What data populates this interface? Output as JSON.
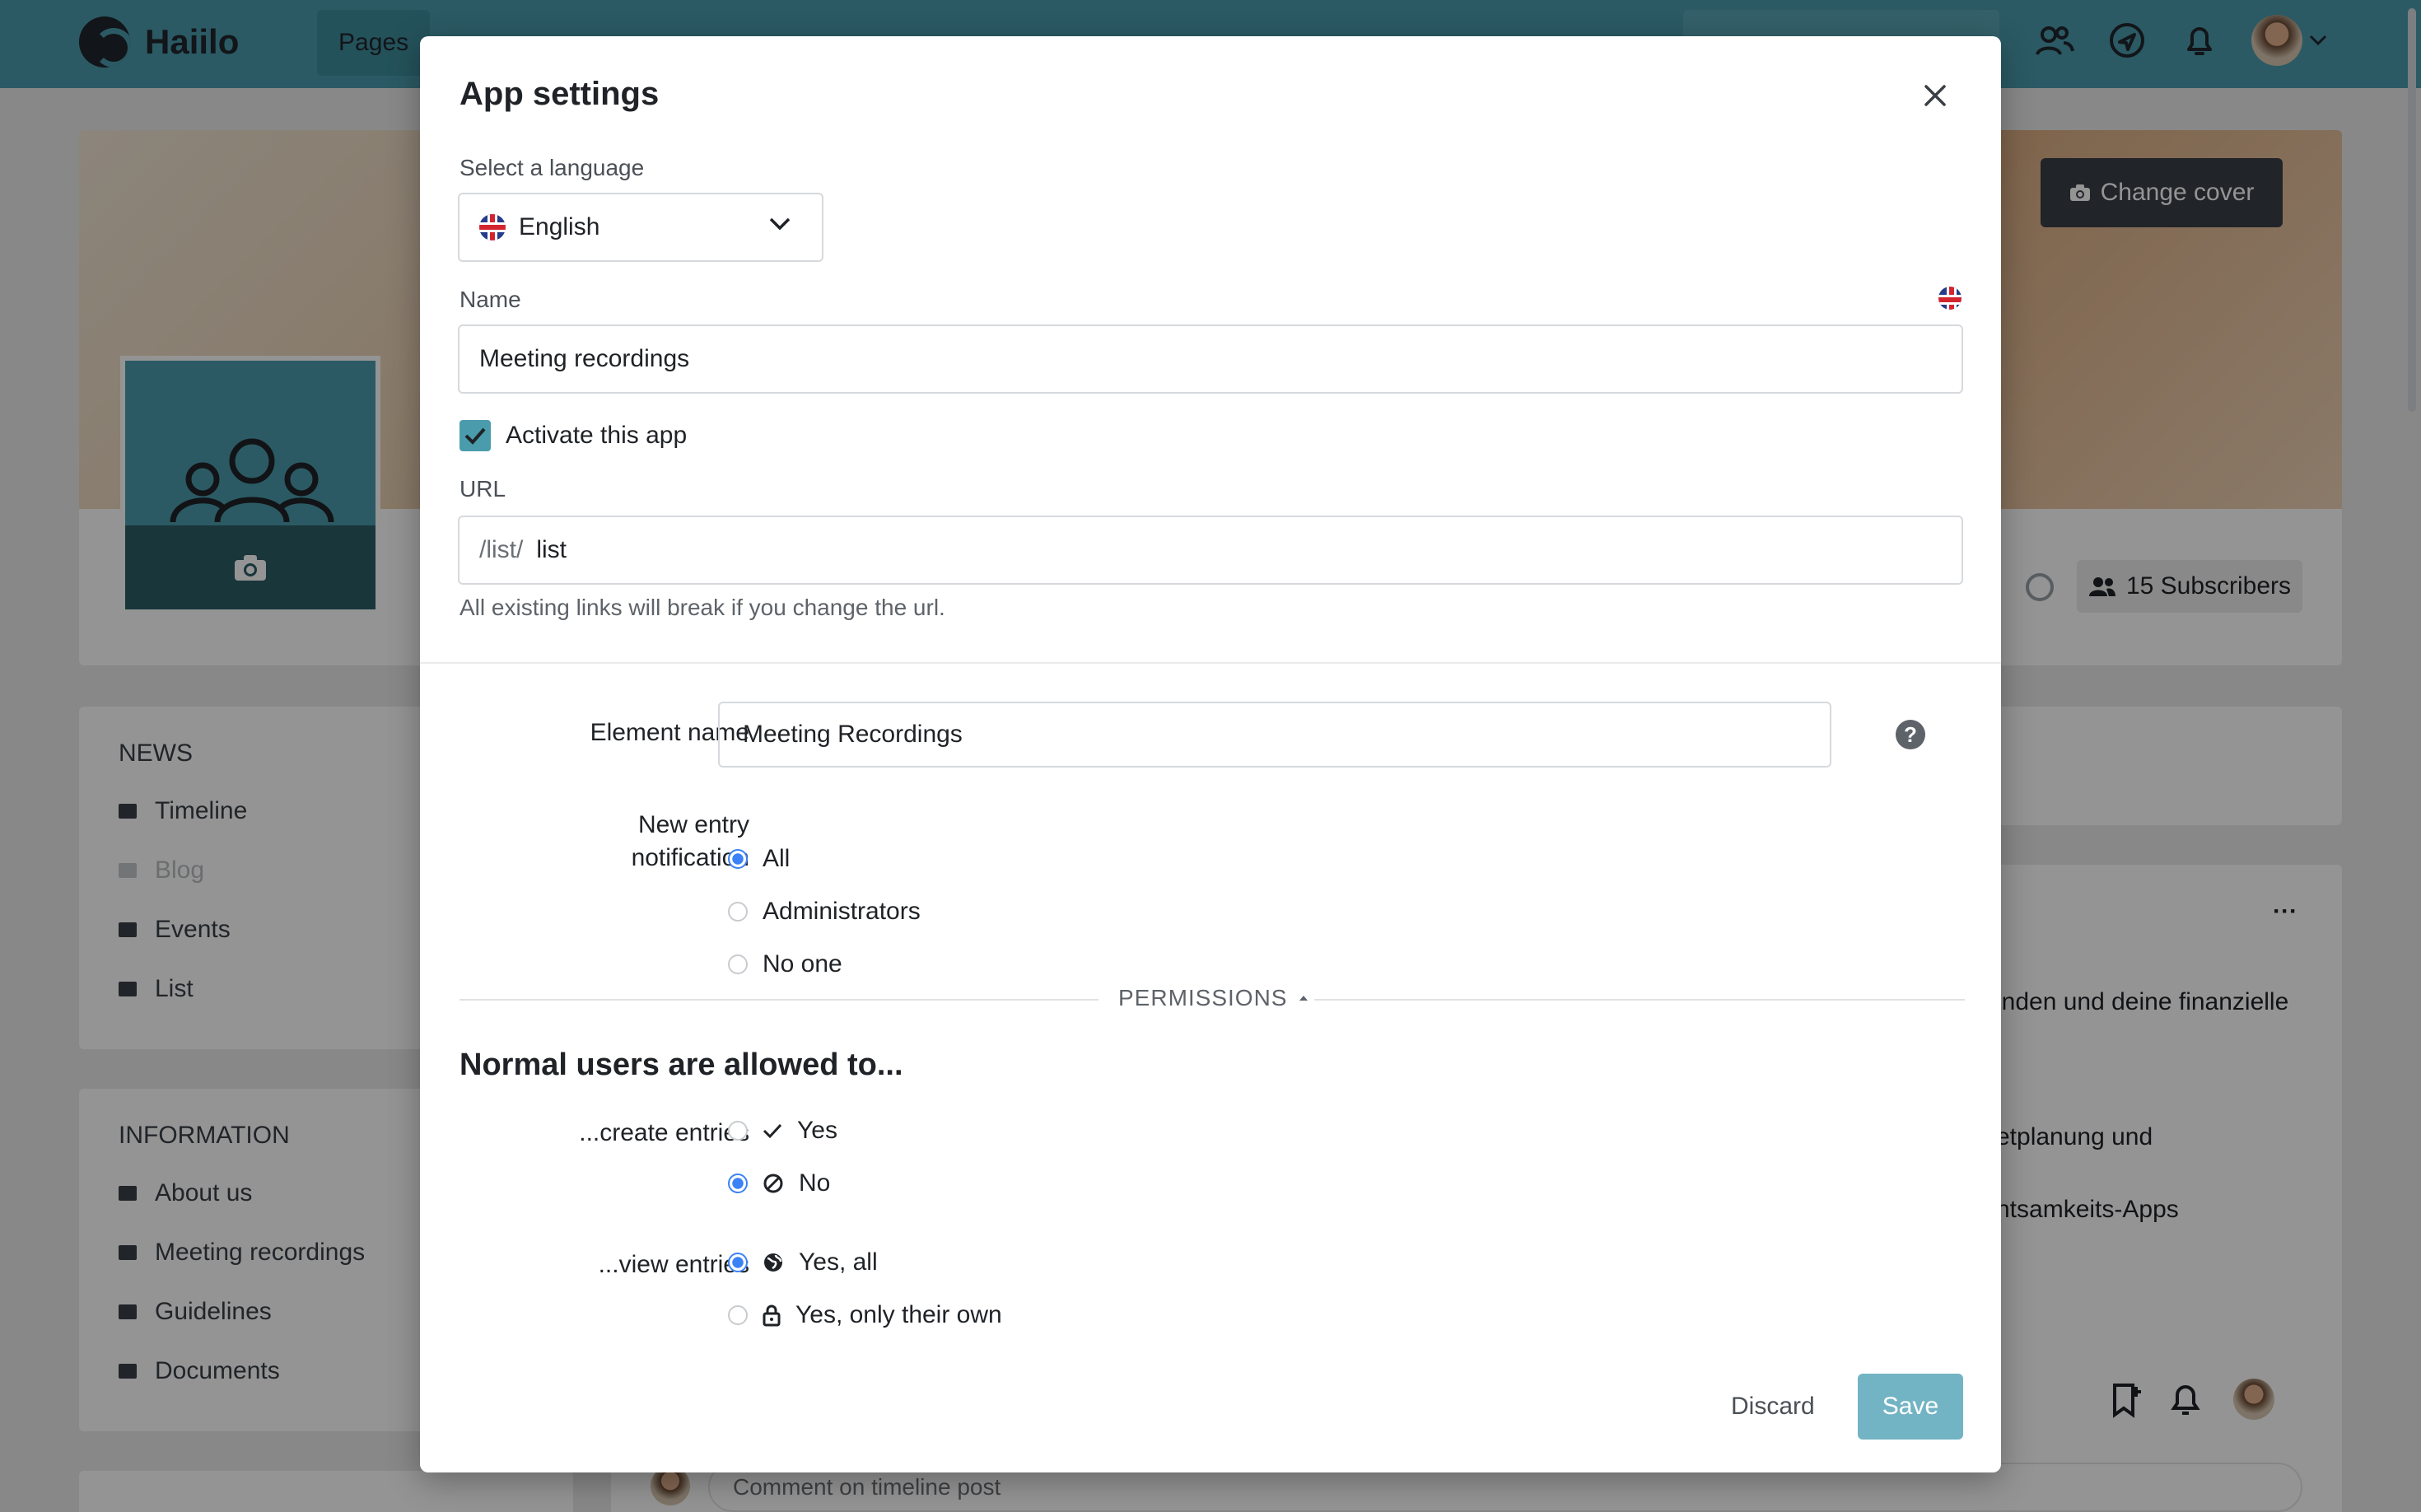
{
  "app": {
    "logo_text": "Haiilo",
    "nav": {
      "pages_label": "Pages"
    }
  },
  "background": {
    "change_cover_label": "Change cover",
    "subscribers_label": "15 Subscribers",
    "news_section": {
      "title": "NEWS",
      "items": [
        {
          "label": "Timeline",
          "enabled": true
        },
        {
          "label": "Blog",
          "enabled": false
        },
        {
          "label": "Events",
          "enabled": true
        },
        {
          "label": "List",
          "enabled": true
        }
      ]
    },
    "info_section": {
      "title": "INFORMATION",
      "items": [
        {
          "label": "About us"
        },
        {
          "label": "Meeting recordings"
        },
        {
          "label": "Guidelines"
        },
        {
          "label": "Documents"
        }
      ]
    },
    "post_snippets": [
      "inden und deine finanzielle",
      "etplanung und",
      "ntsamkeits-Apps"
    ],
    "more_label": "···",
    "comment_placeholder": "Comment on timeline post"
  },
  "modal": {
    "title": "App settings",
    "language": {
      "label": "Select a language",
      "value": "English"
    },
    "name": {
      "label": "Name",
      "value": "Meeting recordings"
    },
    "activate": {
      "label": "Activate this app",
      "checked": true
    },
    "url": {
      "label": "URL",
      "prefix": "/list/",
      "value": "list",
      "hint": "All existing links will break if you change the url."
    },
    "element_name": {
      "label": "Element name",
      "value": "Meeting Recordings"
    },
    "new_entry_notification": {
      "label_line1": "New entry",
      "label_line2": "notification",
      "options": [
        {
          "label": "All",
          "selected": true
        },
        {
          "label": "Administrators",
          "selected": false
        },
        {
          "label": "No one",
          "selected": false
        }
      ]
    },
    "permissions": {
      "divider_label": "PERMISSIONS",
      "heading": "Normal users are allowed to...",
      "create": {
        "label": "...create entries",
        "options": [
          {
            "label": "Yes",
            "icon": "check-icon",
            "selected": false
          },
          {
            "label": "No",
            "icon": "forbidden-icon",
            "selected": true
          }
        ]
      },
      "view": {
        "label": "...view entries",
        "options": [
          {
            "label": "Yes, all",
            "icon": "globe-icon",
            "selected": true
          },
          {
            "label": "Yes, only their own",
            "icon": "lock-icon",
            "selected": false
          }
        ]
      }
    },
    "discard_label": "Discard",
    "save_label": "Save"
  },
  "colors": {
    "brand": "#4a9cad",
    "radio_selected": "#3b82f6",
    "save_button": "#73b4c4"
  }
}
